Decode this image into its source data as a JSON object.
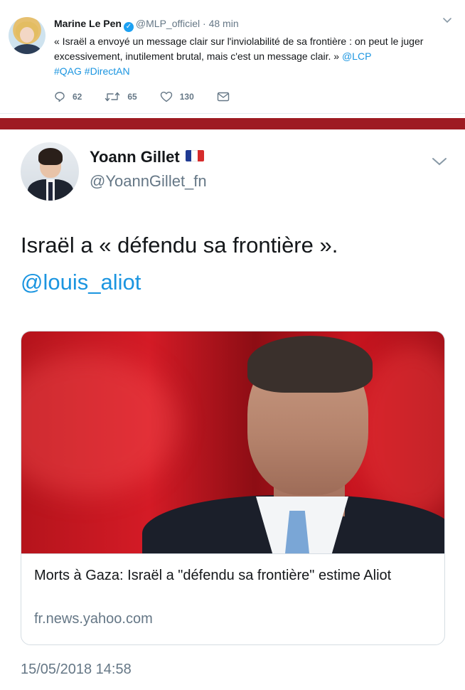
{
  "tweet1": {
    "name": "Marine Le Pen",
    "handle": "@MLP_officiel",
    "dot": "·",
    "time": "48 min",
    "text_before": "« Israël a envoyé un message clair sur l'inviolabilité de sa frontière : on peut le juger excessivement, inutilement brutal, mais c'est un message clair. » ",
    "mention": "@LCP",
    "hashtags": "#QAG #DirectAN",
    "replies": "62",
    "retweets": "65",
    "likes": "130",
    "icons": [
      "chevron-down-icon",
      "reply-icon",
      "retweet-icon",
      "like-icon",
      "dm-icon",
      "verified-icon"
    ]
  },
  "divider_color": "#9e1b22",
  "tweet2": {
    "name": "Yoann Gillet",
    "handle": "@YoannGillet_fn",
    "text": "Israël a « défendu sa frontière ».",
    "mention": "@louis_aliot",
    "card": {
      "title": "Morts à Gaza: Israël a \"défendu sa frontière\" estime Aliot",
      "domain": "fr.news.yahoo.com"
    },
    "timestamp": "15/05/2018 14:58",
    "icons": [
      "french-flag-icon",
      "chevron-down-icon"
    ]
  },
  "colors": {
    "link": "#1b95e0",
    "muted": "#657786",
    "verified": "#1da1f2"
  }
}
